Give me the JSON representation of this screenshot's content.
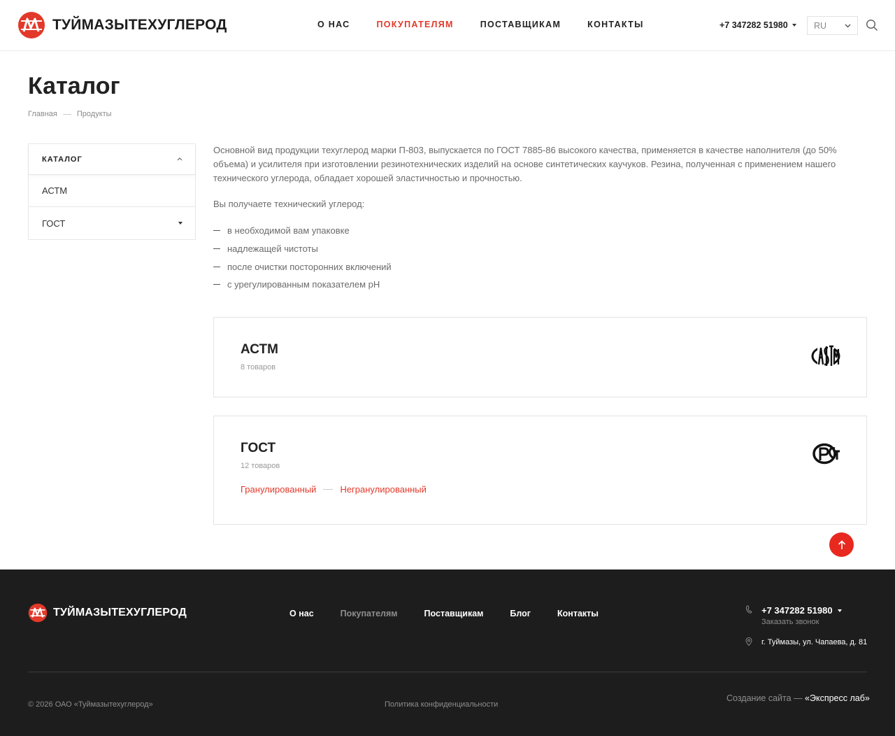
{
  "brand": {
    "name": "ТУЙМАЗЫТЕХУГЛЕРОД",
    "accent": "#e2392a",
    "dark": "#1d1d1d"
  },
  "header": {
    "nav": [
      {
        "label": "О НАС",
        "active": false
      },
      {
        "label": "ПОКУПАТЕЛЯМ",
        "active": true
      },
      {
        "label": "ПОСТАВЩИКАМ",
        "active": false
      },
      {
        "label": "КОНТАКТЫ",
        "active": false
      }
    ],
    "phone": "+7 347282 51980",
    "lang": "RU",
    "search_icon": "search-icon"
  },
  "page": {
    "title": "Каталог",
    "breadcrumb": [
      "Главная",
      "Продукты"
    ]
  },
  "sidebar": {
    "title": "КАТАЛОГ",
    "items": [
      "АСТМ",
      "ГОСТ"
    ]
  },
  "content": {
    "intro": "Основной вид продукции техуглерод марки П-803, выпускается по ГОСТ 7885-86 высокого качества, применяется в качестве наполнителя (до 50% объема) и усилителя при изготовлении резинотехнических изделий на основе синтетических каучуков. Резина, полученная с применением нашего технического углерода, обладает хорошей эластичностью и прочностью.",
    "subtitle": "Вы получаете технический углерод:",
    "features": [
      "в необходимой вам упаковке",
      "надлежащей чистоты",
      "после очистки посторонних включений",
      "с урегулированным показателем pH"
    ]
  },
  "cards": [
    {
      "title": "АСТМ",
      "count": "8 товаров",
      "icon": "astm-logo-icon",
      "links": []
    },
    {
      "title": "ГОСТ",
      "count": "12 товаров",
      "icon": "gost-rst-logo-icon",
      "links": [
        "Гранулированный",
        "Негранулированный"
      ]
    }
  ],
  "footer": {
    "nav": [
      {
        "label": "О нас",
        "muted": false
      },
      {
        "label": "Покупателям",
        "muted": true
      },
      {
        "label": "Поставщикам",
        "muted": false
      },
      {
        "label": "Блог",
        "muted": false
      },
      {
        "label": "Контакты",
        "muted": false
      }
    ],
    "phone": "+7 347282 51980",
    "callback": "Заказать звонок",
    "address": "г. Туймазы, ул. Чапаева, д. 81",
    "copyright": "© 2026 ОАО «Туймазытехуглерод»",
    "policy": "Политика конфиденциальности",
    "made_by_prefix": "Создание сайта — ",
    "made_by_studio": "«Экспресс лаб»"
  }
}
